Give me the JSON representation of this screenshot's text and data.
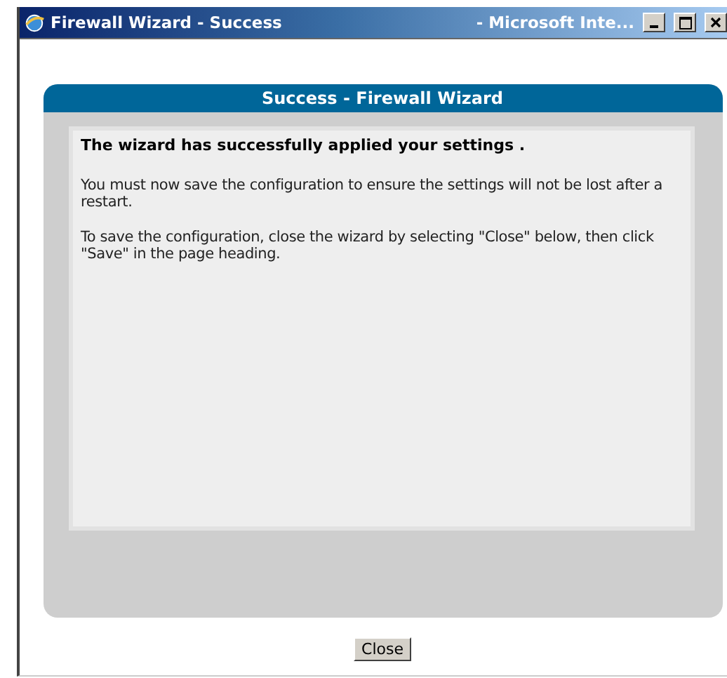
{
  "window": {
    "title": "Firewall Wizard - Success",
    "app_title": "- Microsoft Inte...",
    "controls": [
      {
        "kind": "minimize"
      },
      {
        "kind": "maximize"
      },
      {
        "kind": "close"
      }
    ]
  },
  "panel": {
    "title": "Success - Firewall Wizard",
    "heading": "The wizard has successfully applied your settings .",
    "paragraphs": [
      "You must now save the configuration to ensure the settings will not be lost after a restart.",
      "To save the configuration, close the wizard by selecting \"Close\" below, then click \"Save\" in the page heading."
    ]
  },
  "buttons": [
    "Close"
  ]
}
